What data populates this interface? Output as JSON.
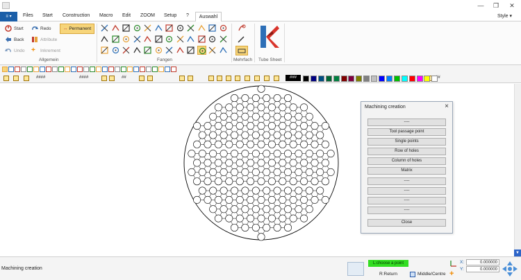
{
  "menu": {
    "app_button": "≡ ▾",
    "items": [
      "Files",
      "Start",
      "Construction",
      "Macro",
      "Edit",
      "ZOOM",
      "Setup",
      "?"
    ],
    "active_tab": "Auswahl",
    "style": "Style ▾"
  },
  "ribbon": {
    "allgemein": {
      "start": "Start",
      "redo": "Redo",
      "permanent": "Permanent",
      "back": "Back",
      "attribute": "Attribute",
      "undo": "Undo",
      "inkrement": "Inkrement",
      "group_label": "Allgemein"
    },
    "fangen_label": "Fangen",
    "mehrfach_label": "Mehrfach",
    "tube_sheet_label": "Tube Sheet"
  },
  "toolbar": {
    "hash1": "####",
    "hash2": "####",
    "hash3": "##",
    "hash4": "###",
    "hash5": "##",
    "colors": [
      "#000000",
      "#000080",
      "#004d80",
      "#006633",
      "#008040",
      "#800000",
      "#800040",
      "#808000",
      "#808080",
      "#c0c0c0",
      "#0000ff",
      "#0080ff",
      "#00c000",
      "#00ffff",
      "#ff0000",
      "#ff00ff",
      "#ffff00",
      "#ffffff"
    ]
  },
  "dialog": {
    "title": "Machining creation",
    "close_icon": "×",
    "buttons": [
      "----",
      "Tool passage point",
      "Single points",
      "Row of holes",
      "Column of holes",
      "Matrix",
      "----",
      "----",
      "----",
      "----",
      "Close"
    ]
  },
  "status": {
    "text": "Machining creation",
    "prompt": "L:choose a point",
    "rreturn": "R:Return",
    "middle_centre": "Middle/Centre",
    "x_label": "X:",
    "y_label": "Y:",
    "x_value": "0.000000",
    "y_value": "0.000000"
  },
  "drawing": {
    "description_icons": "tube-sheet-circle-icon",
    "outline_color": "#000000"
  }
}
